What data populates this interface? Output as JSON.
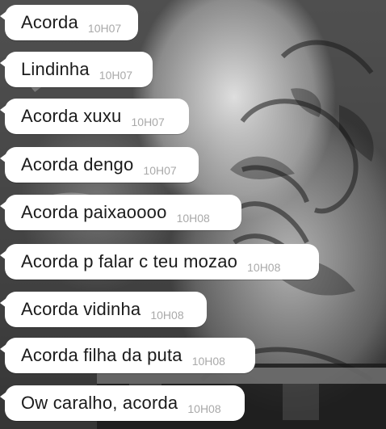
{
  "conversation": {
    "messages": [
      {
        "text": "Acorda",
        "time": "10H07"
      },
      {
        "text": "Lindinha",
        "time": "10H07"
      },
      {
        "text": "Acorda xuxu",
        "time": "10H07"
      },
      {
        "text": "Acorda dengo",
        "time": "10H07"
      },
      {
        "text": "Acorda paixaoooo",
        "time": "10H08"
      },
      {
        "text": "Acorda p falar c teu mozao",
        "time": "10H08"
      },
      {
        "text": "Acorda vidinha",
        "time": "10H08"
      },
      {
        "text": "Acorda filha da puta",
        "time": "10H08"
      },
      {
        "text": "Ow caralho, acorda",
        "time": "10H08"
      }
    ]
  }
}
